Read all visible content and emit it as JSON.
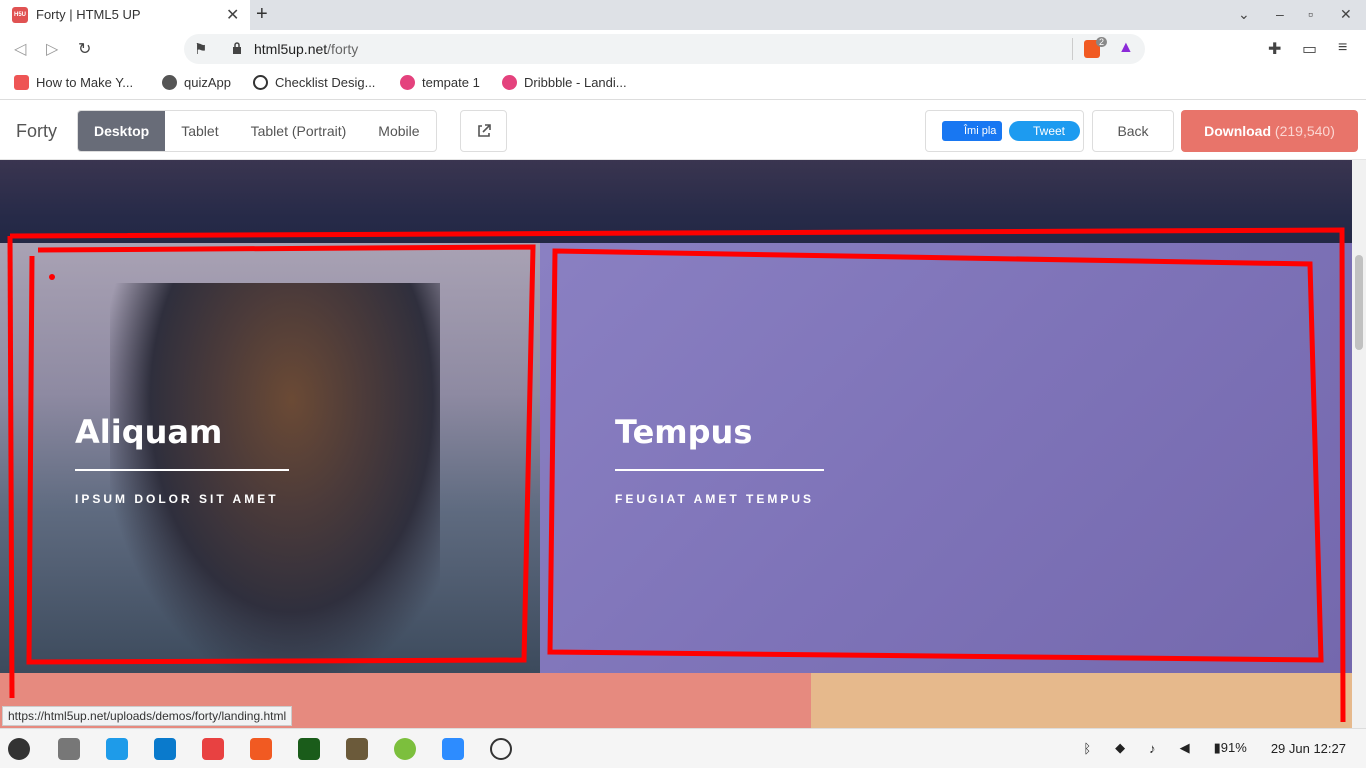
{
  "browser": {
    "tab_title": "Forty | HTML5 UP",
    "tab_favicon_text": "H5U",
    "new_tab": "+",
    "url_host": "html5up.net",
    "url_path": "/forty",
    "shields_badge": "2",
    "bookmarks": [
      {
        "label": "How to Make Y...",
        "color": "#e55"
      },
      {
        "label": "quizApp",
        "color": "#555"
      },
      {
        "label": "Checklist Desig...",
        "color": "#333"
      },
      {
        "label": "tempate 1",
        "color": "#e4427d"
      },
      {
        "label": "Dribbble - Landi...",
        "color": "#e4427d"
      }
    ]
  },
  "site_bar": {
    "brand": "Forty",
    "views": [
      "Desktop",
      "Tablet",
      "Tablet (Portrait)",
      "Mobile"
    ],
    "active_view": "Desktop",
    "fb_like": "Îmi pla",
    "tweet": "Tweet",
    "back": "Back",
    "download": "Download",
    "download_count": "(219,540)"
  },
  "tiles": [
    {
      "title": "Aliquam",
      "subtitle": "IPSUM DOLOR SIT AMET"
    },
    {
      "title": "Tempus",
      "subtitle": "FEUGIAT AMET TEMPUS"
    }
  ],
  "status_url": "https://html5up.net/uploads/demos/forty/landing.html",
  "tray": {
    "battery": "91%",
    "datetime": "29 Jun 12:27"
  }
}
